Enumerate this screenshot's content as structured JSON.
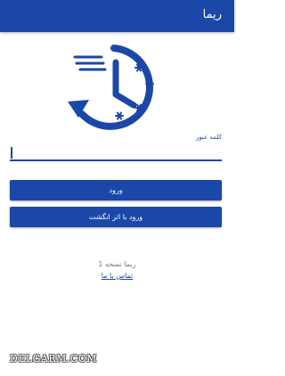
{
  "app": {
    "title": "ریما"
  },
  "logo": {
    "icon": "clock-snowflake-icon"
  },
  "login": {
    "password_label": "کلمه عبور",
    "password_value": "",
    "login_button": "ورود",
    "fingerprint_button": "ورود با اثر انگشت"
  },
  "footer": {
    "version": "ریما نسخه 1",
    "contact": "تماس با ما"
  },
  "watermark": "DELGARM.COM",
  "colors": {
    "primary": "#1a47a8",
    "muted": "#7a7a7a",
    "background": "#ffffff"
  }
}
